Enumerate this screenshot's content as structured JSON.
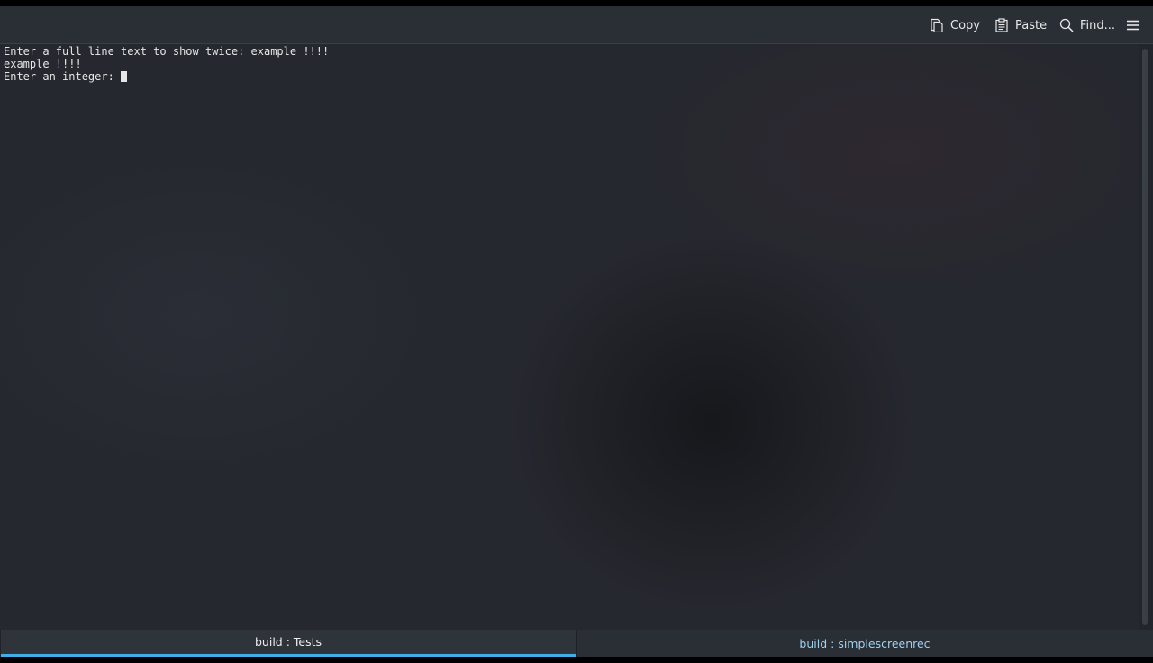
{
  "toolbar": {
    "copy_label": "Copy",
    "paste_label": "Paste",
    "find_label": "Find...",
    "icons": {
      "copy": "copy-icon",
      "paste": "paste-icon",
      "find": "search-icon",
      "menu": "hamburger-menu-icon"
    }
  },
  "terminal": {
    "lines": [
      "Enter a full line text to show twice: example !!!!",
      "example !!!!",
      "Enter an integer: "
    ]
  },
  "tabs": [
    {
      "label": "build : Tests",
      "active": true
    },
    {
      "label": "build : simplescreenrec",
      "active": false
    }
  ],
  "colors": {
    "accent": "#3daee9",
    "inactive_tab_text": "#9fd2f0",
    "terminal_text": "#e6e6e6"
  }
}
